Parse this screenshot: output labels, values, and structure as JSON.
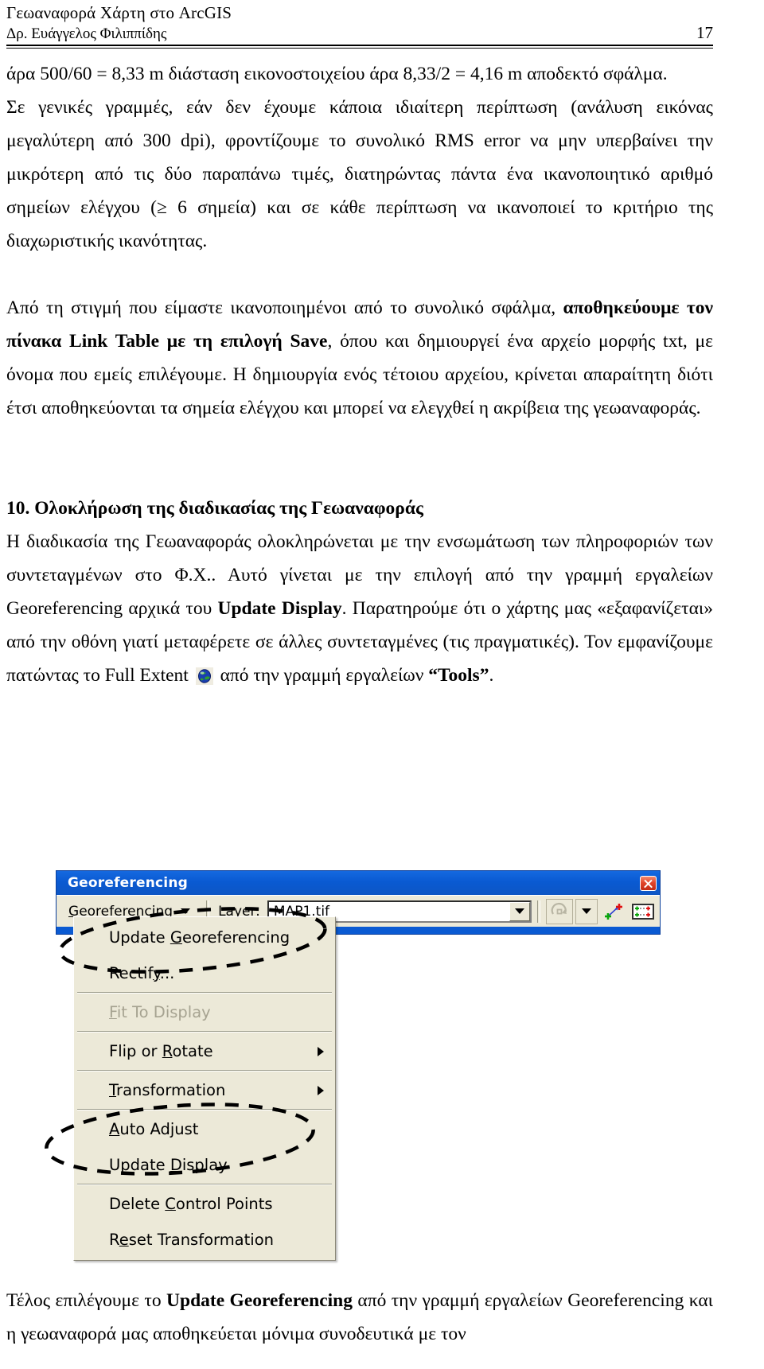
{
  "header": {
    "title": "Γεωαναφορά Χάρτη στο ArcGIS",
    "author": "Δρ. Ευάγγελος Φιλιππίδης",
    "page_number": "17"
  },
  "body": {
    "para1": "άρα 500/60 = 8,33 m διάσταση εικονοστοιχείου άρα 8,33/2 = 4,16 m αποδεκτό σφάλμα.",
    "para2": "Σε γενικές γραμμές, εάν δεν έχουμε κάποια ιδιαίτερη περίπτωση (ανάλυση εικόνας μεγαλύτερη από 300 dpi), φροντίζουμε το συνολικό RMS error να μην υπερβαίνει την μικρότερη από τις δύο παραπάνω τιμές, διατηρώντας πάντα ένα ικανοποιητικό αριθμό σημείων ελέγχου (≥ 6 σημεία) και σε κάθε περίπτωση να ικανοποιεί το κριτήριο της διαχωριστικής ικανότητας.",
    "para3_a": "Από τη στιγμή που είμαστε ικανοποιημένοι από το συνολικό σφάλμα, ",
    "para3_bold": "αποθηκεύουμε τον πίνακα Link Table με τη επιλογή Save",
    "para3_b": ", όπου και δημιουργεί ένα αρχείο μορφής txt, με όνομα που εμείς επιλέγουμε. Η δημιουργία ενός τέτοιου αρχείου, κρίνεται απαραίτητη διότι έτσι αποθηκεύονται τα σημεία ελέγχου και μπορεί να ελεγχθεί η ακρίβεια της γεωαναφοράς.",
    "section_heading": "10. Ολοκλήρωση της διαδικασίας της Γεωαναφοράς",
    "para4_a": "Η διαδικασία της Γεωαναφοράς ολοκληρώνεται με την ενσωμάτωση των πληροφοριών των συντεταγμένων στο Φ.Χ.. Αυτό γίνεται με την επιλογή από την γραμμή εργαλείων Georeferencing αρχικά του ",
    "para4_bold": "Update Display",
    "para4_b": ". Παρατηρούμε ότι ο χάρτης μας «εξαφανίζεται» από την οθόνη γιατί μεταφέρετε σε άλλες συντεταγμένες (τις πραγματικές). Τον εμφανίζουμε πατώντας το Full Extent ",
    "para4_c": " από την γραμμή εργαλείων ",
    "para4_bold2": "“Tools”",
    "para4_d": "."
  },
  "footer": {
    "text_a": "Τέλος επιλέγουμε το ",
    "text_bold": "Update Georeferencing",
    "text_b": " από την γραμμή εργαλείων Georeferencing και η γεωαναφορά μας αποθηκεύεται μόνιμα συνοδευτικά με τον"
  },
  "georeferencing_window": {
    "title": "Georeferencing",
    "close_tooltip": "Close",
    "menu_button": {
      "label": "Georeferencing",
      "accel_char": "G"
    },
    "layer_label": "Layer:",
    "layer_value": "MAP1.tif",
    "tools": [
      {
        "name": "rotate-icon",
        "enabled": false
      },
      {
        "name": "rotate-dropdown-icon",
        "enabled": true
      },
      {
        "name": "add-control-points-icon",
        "enabled": true
      },
      {
        "name": "view-link-table-icon",
        "enabled": true
      }
    ],
    "menu_items": [
      {
        "label": "Update Georeferencing",
        "accel": "G",
        "disabled": false,
        "submenu": false,
        "sep_after": false
      },
      {
        "label": "Rectify...",
        "accel": "y",
        "disabled": false,
        "submenu": false,
        "sep_after": true
      },
      {
        "label": "Fit To Display",
        "accel": "F",
        "disabled": true,
        "submenu": false,
        "sep_after": true
      },
      {
        "label": "Flip or Rotate",
        "accel": "R",
        "disabled": false,
        "submenu": true,
        "sep_after": true
      },
      {
        "label": "Transformation",
        "accel": "T",
        "disabled": false,
        "submenu": true,
        "sep_after": true
      },
      {
        "label": "Auto Adjust",
        "accel": "A",
        "disabled": false,
        "submenu": false,
        "sep_after": false
      },
      {
        "label": "Update Display",
        "accel": "D",
        "disabled": false,
        "submenu": false,
        "sep_after": true
      },
      {
        "label": "Delete Control Points",
        "accel": "C",
        "disabled": false,
        "submenu": false,
        "sep_after": false
      },
      {
        "label": "Reset Transformation",
        "accel": "e",
        "disabled": false,
        "submenu": false,
        "sep_after": false
      }
    ]
  },
  "annotations": [
    {
      "name": "highlight-update-georeferencing",
      "shape": "dashed-ellipse"
    },
    {
      "name": "highlight-update-display",
      "shape": "dashed-ellipse"
    }
  ],
  "colors": {
    "titlebar_blue": "#0a5ad2",
    "menu_face": "#ece9d8",
    "close_red": "#e2452b",
    "disabled_text": "#a6a391",
    "text": "#000000"
  }
}
